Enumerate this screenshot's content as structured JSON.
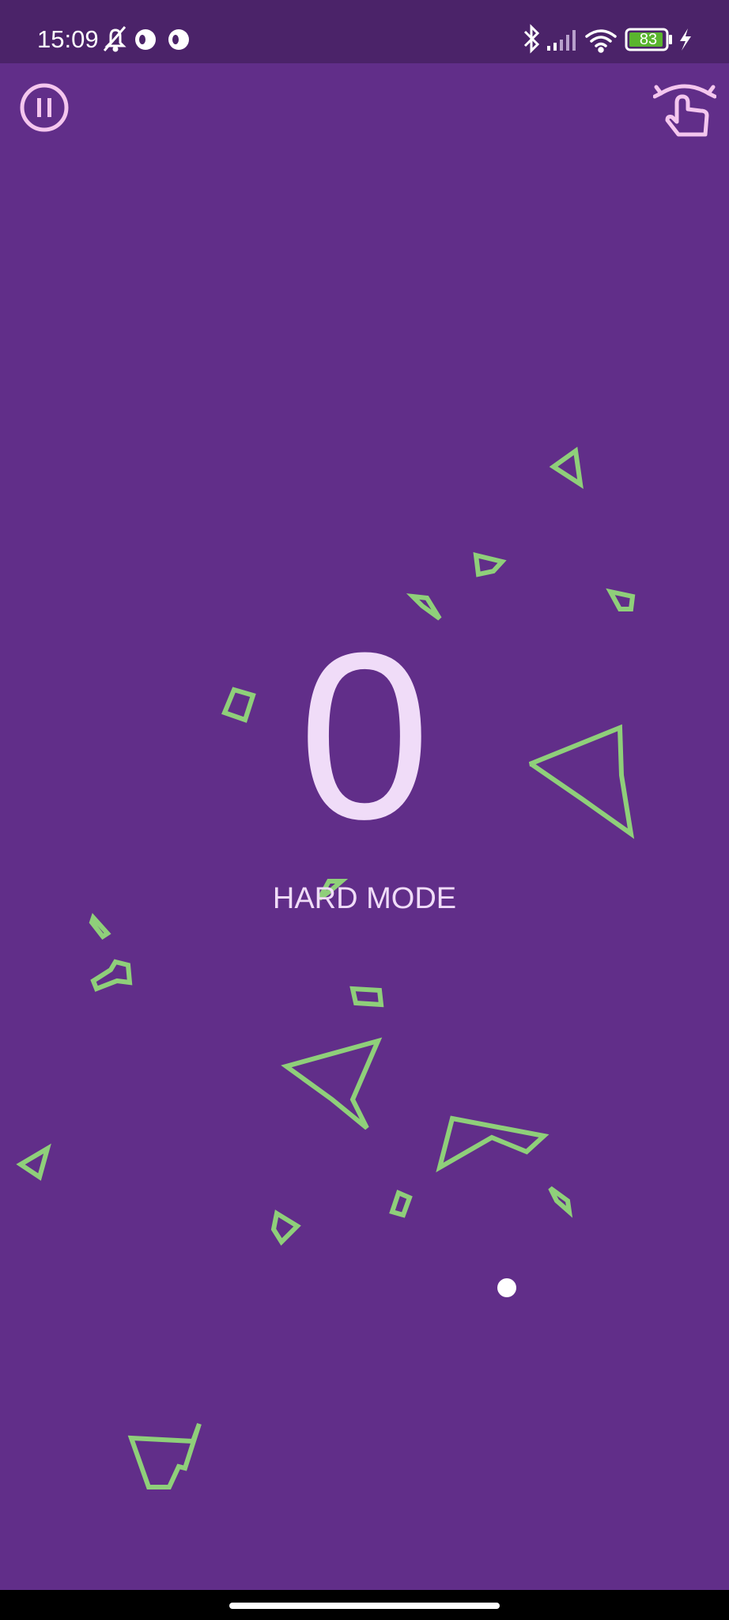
{
  "status_bar": {
    "time": "15:09",
    "battery_level": "83",
    "icons": [
      "bell-off-icon",
      "app-notification-icon",
      "app-notification-icon",
      "bluetooth-icon",
      "signal-icon",
      "wifi-icon",
      "battery-icon",
      "charging-icon"
    ]
  },
  "controls": {
    "pause_icon": "pause-icon",
    "rotate_icon": "rotate-touch-icon"
  },
  "game": {
    "score": "0",
    "mode": "HARD MODE",
    "asteroid_color": "#8fcf7a",
    "background_color": "#612e89",
    "score_color": "#f0dcf8"
  },
  "colors": {
    "status_bar": "#4b2369",
    "background": "#612e89",
    "asteroid": "#8fcf7a",
    "player": "#ffffff",
    "icon_pink": "#f4c6ee"
  }
}
